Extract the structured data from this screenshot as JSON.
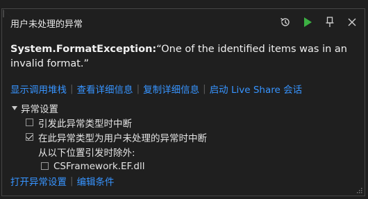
{
  "header": {
    "title": "用户未处理的异常",
    "tools": [
      {
        "icon": "history-icon"
      },
      {
        "icon": "continue-icon",
        "color": "#3cb043"
      },
      {
        "icon": "pin-icon"
      },
      {
        "icon": "close-icon"
      }
    ]
  },
  "exception": {
    "type": "System.FormatException:",
    "message": "“One of the identified items was in an invalid format.”"
  },
  "actions": [
    {
      "label": "显示调用堆栈"
    },
    {
      "label": "查看详细信息"
    },
    {
      "label": "复制详细信息"
    },
    {
      "label": "启动 Live Share 会话"
    }
  ],
  "settings": {
    "section_label": "异常设置",
    "option_break_thrown": {
      "label": "引发此异常类型时中断",
      "checked": false
    },
    "option_break_unhandled": {
      "label": "在此异常类型为用户未处理的异常时中断",
      "checked": true
    },
    "except_label": "从以下位置引发时除外:",
    "except_item": {
      "label": "CSFramework.EF.dll",
      "checked": false
    }
  },
  "footer": {
    "open_settings": "打开异常设置",
    "edit_conditions": "编辑条件"
  },
  "colors": {
    "background": "#1f1f1f",
    "link": "#3794ff",
    "accent_green": "#3cb043"
  }
}
